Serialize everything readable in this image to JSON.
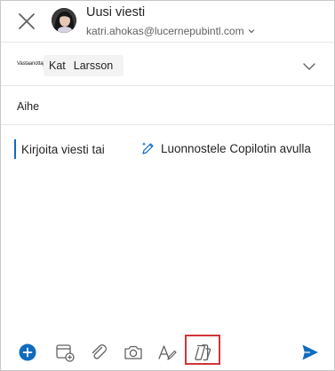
{
  "header": {
    "title": "Uusi viesti",
    "from_email": "katri.ahokas@lucernepubintl.com"
  },
  "to_row": {
    "label": "Vastaanottaja",
    "recipient_first": "Kat",
    "recipient_last": "Larsson"
  },
  "subject": {
    "placeholder": "Aihe"
  },
  "body": {
    "prompt": "Kirjoita viesti tai",
    "copilot_link": "Luonnostele Copilotin avulla"
  },
  "colors": {
    "accent": "#0f6cbd",
    "highlight": "#d13438"
  },
  "toolbar": {
    "icons": [
      "add-icon",
      "calendar-add-icon",
      "attach-icon",
      "camera-icon",
      "format-icon",
      "copilot-icon",
      "send-icon"
    ]
  }
}
